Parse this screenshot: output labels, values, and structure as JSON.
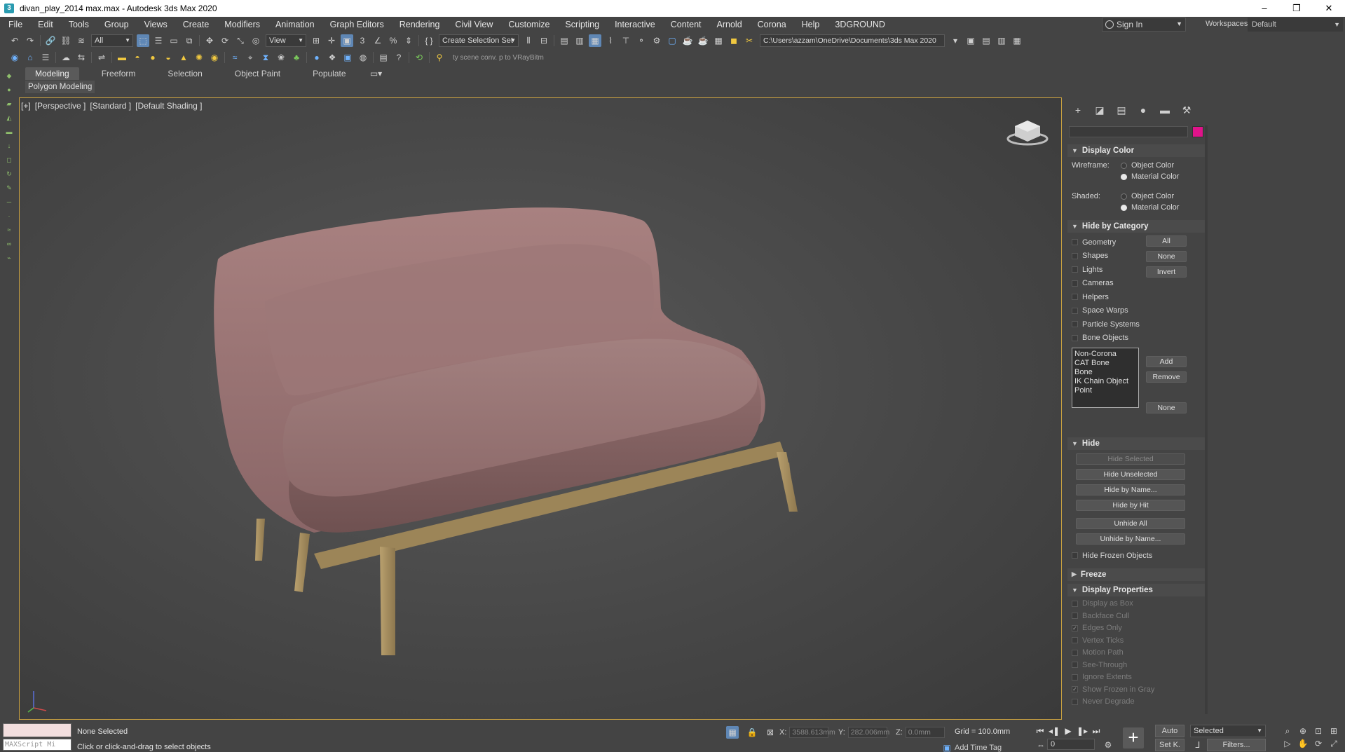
{
  "window": {
    "title": "divan_play_2014 max.max - Autodesk 3ds Max 2020",
    "minimize": "–",
    "restore": "❐",
    "close": "✕"
  },
  "menu": [
    "File",
    "Edit",
    "Tools",
    "Group",
    "Views",
    "Create",
    "Modifiers",
    "Animation",
    "Graph Editors",
    "Rendering",
    "Civil View",
    "Customize",
    "Scripting",
    "Interactive",
    "Content",
    "Arnold",
    "Corona",
    "Help",
    "3DGROUND"
  ],
  "account": {
    "sign_in": "Sign In",
    "workspaces_label": "Workspaces:",
    "workspace_value": "Default"
  },
  "toolbar": {
    "filter_value": "All",
    "ref_coord_value": "View",
    "selection_set_placeholder": "Create Selection Set",
    "project_path": "C:\\Users\\azzam\\OneDrive\\Documents\\3ds Max 2020",
    "scene_conv_hint": "ty scene conv. p to VRayBitm"
  },
  "ribbon": {
    "tabs": [
      "Modeling",
      "Freeform",
      "Selection",
      "Object Paint",
      "Populate"
    ],
    "active_tab": "Modeling",
    "sub_label": "Polygon Modeling"
  },
  "viewport": {
    "labels": [
      "[+]",
      "[Perspective ]",
      "[Standard ]",
      "[Default Shading ]"
    ]
  },
  "command_panel": {
    "object_color": "#e0138a",
    "display_color": {
      "title": "Display Color",
      "wireframe_label": "Wireframe:",
      "shaded_label": "Shaded:",
      "object_color": "Object Color",
      "material_color": "Material Color"
    },
    "hide_by_category": {
      "title": "Hide by Category",
      "items": [
        "Geometry",
        "Shapes",
        "Lights",
        "Cameras",
        "Helpers",
        "Space Warps",
        "Particle Systems",
        "Bone Objects"
      ],
      "btn_all": "All",
      "btn_none": "None",
      "btn_invert": "Invert",
      "list": [
        "Non-Corona",
        "CAT Bone",
        "Bone",
        "IK Chain Object",
        "Point"
      ],
      "btn_add": "Add",
      "btn_remove": "Remove",
      "btn_list_none": "None"
    },
    "hide": {
      "title": "Hide",
      "hide_selected": "Hide Selected",
      "hide_unselected": "Hide Unselected",
      "hide_by_name": "Hide by Name...",
      "hide_by_hit": "Hide by Hit",
      "unhide_all": "Unhide All",
      "unhide_by_name": "Unhide by Name...",
      "hide_frozen": "Hide Frozen Objects"
    },
    "freeze": {
      "title": "Freeze"
    },
    "display_properties": {
      "title": "Display Properties",
      "items": [
        "Display as Box",
        "Backface Cull",
        "Edges Only",
        "Vertex Ticks",
        "Motion Path",
        "See-Through",
        "Ignore Extents",
        "Show Frozen in Gray",
        "Never Degrade"
      ],
      "checked": [
        "Edges Only",
        "Show Frozen in Gray"
      ]
    }
  },
  "status": {
    "maxscript_label": "MAXScript Mi",
    "selection": "None Selected",
    "prompt": "Click or click-and-drag to select objects",
    "x_label": "X:",
    "x_value": "3588.613mm",
    "y_label": "Y:",
    "y_value": "282.006mm",
    "z_label": "Z:",
    "z_value": "0.0mm",
    "grid": "Grid = 100.0mm",
    "add_time_tag": "Add Time Tag",
    "auto": "Auto",
    "set_key": "Set K.",
    "key_filter": "Selected",
    "filters": "Filters...",
    "frame": "0"
  }
}
